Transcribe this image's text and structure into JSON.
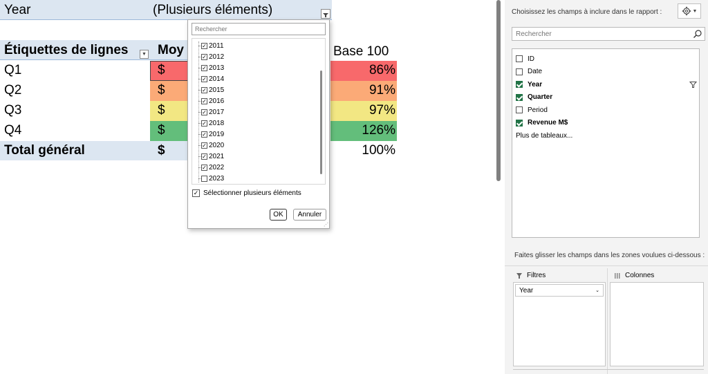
{
  "pivot": {
    "filter_field": "Year",
    "filter_value": "(Plusieurs éléments)",
    "header_rows_label": "Étiquettes de lignes",
    "header_avg_partial": "Moy",
    "header_base": "Base 100",
    "rows": [
      {
        "label": "Q1",
        "currency": "$",
        "base": "86%",
        "color": "#f8696b"
      },
      {
        "label": "Q2",
        "currency": "$",
        "base": "91%",
        "color": "#fbaa77"
      },
      {
        "label": "Q3",
        "currency": "$",
        "base": "97%",
        "color": "#f2e783"
      },
      {
        "label": "Q4",
        "currency": "$",
        "base": "126%",
        "color": "#63be7b"
      }
    ],
    "total": {
      "label": "Total général",
      "currency": "$",
      "base": "100%"
    }
  },
  "dropdown": {
    "search_placeholder": "Rechercher",
    "items": [
      {
        "label": "2011",
        "checked": true
      },
      {
        "label": "2012",
        "checked": true
      },
      {
        "label": "2013",
        "checked": true
      },
      {
        "label": "2014",
        "checked": true
      },
      {
        "label": "2015",
        "checked": true
      },
      {
        "label": "2016",
        "checked": true
      },
      {
        "label": "2017",
        "checked": true
      },
      {
        "label": "2018",
        "checked": true
      },
      {
        "label": "2019",
        "checked": true
      },
      {
        "label": "2020",
        "checked": true
      },
      {
        "label": "2021",
        "checked": true
      },
      {
        "label": "2022",
        "checked": true
      },
      {
        "label": "2023",
        "checked": false
      }
    ],
    "multi_select_label": "Sélectionner plusieurs éléments",
    "multi_select_checked": true,
    "ok_label": "OK",
    "cancel_label": "Annuler"
  },
  "pane": {
    "choose_fields_label": "Choisissez les champs à inclure dans le rapport :",
    "search_placeholder": "Rechercher",
    "fields": [
      {
        "label": "ID",
        "checked": false,
        "bold": false,
        "filtered": false
      },
      {
        "label": "Date",
        "checked": false,
        "bold": false,
        "filtered": false
      },
      {
        "label": "Year",
        "checked": true,
        "bold": true,
        "filtered": true
      },
      {
        "label": "Quarter",
        "checked": true,
        "bold": true,
        "filtered": false
      },
      {
        "label": "Period",
        "checked": false,
        "bold": false,
        "filtered": false
      },
      {
        "label": "Revenue M$",
        "checked": true,
        "bold": true,
        "filtered": false
      }
    ],
    "more_tables": "Plus de tableaux...",
    "drag_label": "Faites glisser les champs dans les zones voulues ci-dessous :",
    "filters_label": "Filtres",
    "columns_label": "Colonnes",
    "filter_chip": "Year",
    "accent": "#217346"
  }
}
